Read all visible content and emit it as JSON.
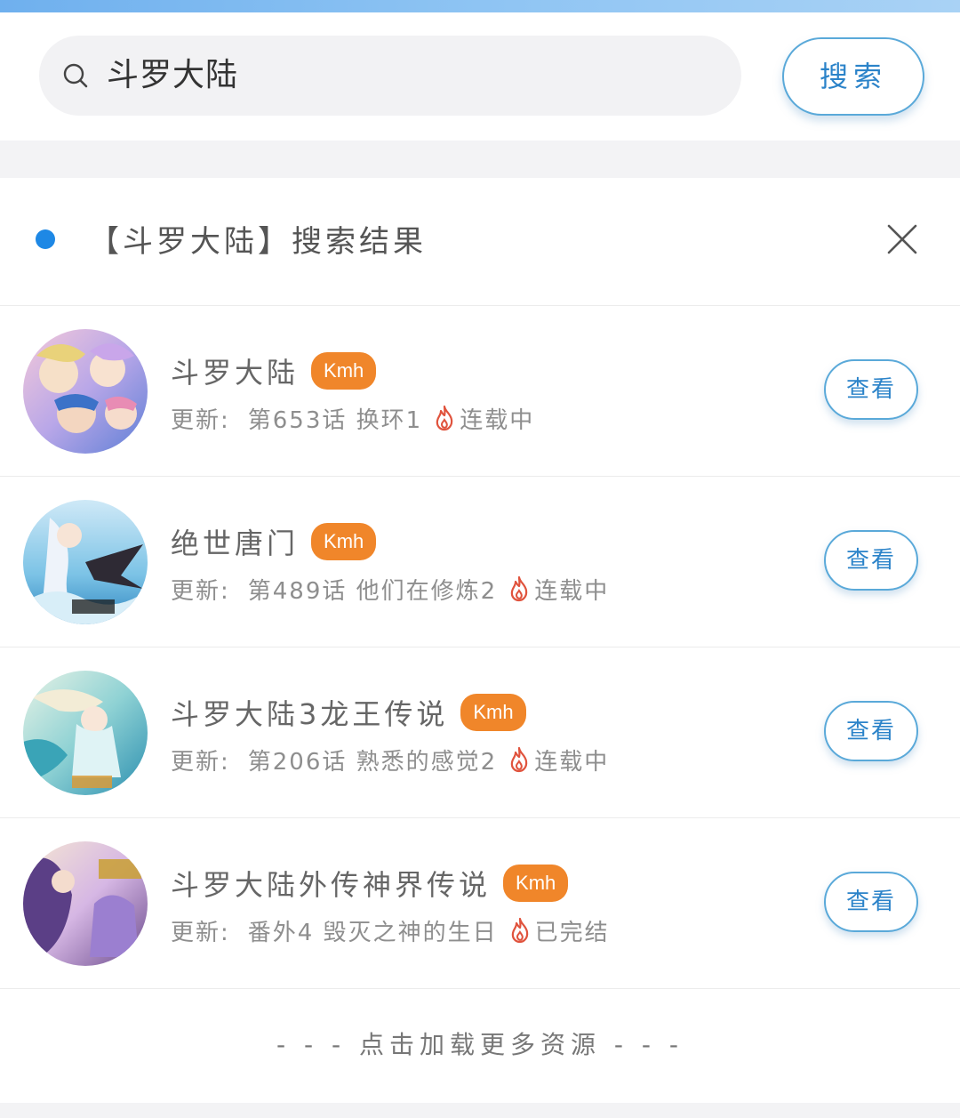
{
  "search": {
    "query": "斗罗大陆",
    "button_label": "搜索"
  },
  "results_header": {
    "title": "【斗罗大陆】搜索结果"
  },
  "results": [
    {
      "title": "斗罗大陆",
      "source_tag": "Kmh",
      "update_prefix": "更新:",
      "latest": "第653话 换环1",
      "status": "连载中",
      "action_label": "查看"
    },
    {
      "title": "绝世唐门",
      "source_tag": "Kmh",
      "update_prefix": "更新:",
      "latest": "第489话 他们在修炼2",
      "status": "连载中",
      "action_label": "查看"
    },
    {
      "title": "斗罗大陆3龙王传说",
      "source_tag": "Kmh",
      "update_prefix": "更新:",
      "latest": "第206话 熟悉的感觉2",
      "status": "连载中",
      "action_label": "查看"
    },
    {
      "title": "斗罗大陆外传神界传说",
      "source_tag": "Kmh",
      "update_prefix": "更新:",
      "latest": "番外4 毁灭之神的生日",
      "status": "已完结",
      "action_label": "查看"
    }
  ],
  "load_more": "- - - 点击加载更多资源 - - -",
  "colors": {
    "accent_blue": "#1e88e5",
    "button_border": "#5aa9d9",
    "tag_orange": "#f0862a",
    "fire_red": "#e0533d"
  },
  "icons": {
    "search": "search-icon",
    "close": "close-icon",
    "status": "fire-icon"
  }
}
